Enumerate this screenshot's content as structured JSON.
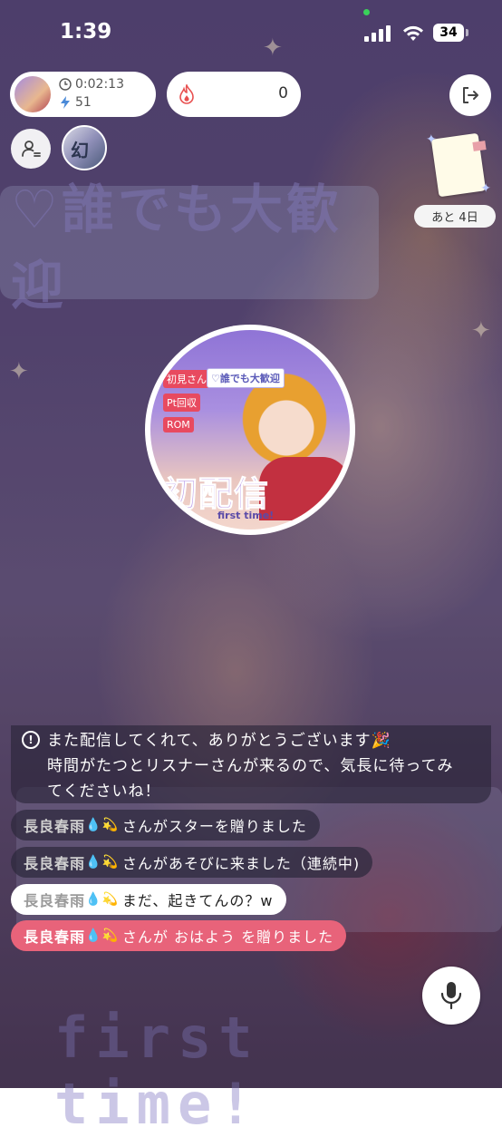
{
  "status_bar": {
    "time": "1:39",
    "battery": "34"
  },
  "stream_info": {
    "elapsed": "0:02:13",
    "count": "51",
    "score": "0"
  },
  "event": {
    "days_left": "あと 4日"
  },
  "background": {
    "banner_text": "♡誰でも大歓迎",
    "bottom_text": "first time!"
  },
  "cover": {
    "tag_1": "初見さん",
    "tag_2": "Pt回収",
    "tag_3": "ROM",
    "tag_welcome": "♡誰でも大歓迎",
    "title": "初配信",
    "subtitle": "first time!"
  },
  "chat": {
    "system": {
      "line1": "また配信してくれて、ありがとうございます🎉",
      "line2": "時間がたつとリスナーさんが来るので、気長に待ってみ",
      "line3": "てくださいね！"
    },
    "messages": [
      {
        "name": "長良春雨",
        "emoji": "💧💫",
        "text": " さんがスターを贈りました"
      },
      {
        "name": "長良春雨",
        "emoji": "💧💫",
        "text": "さんがあそびに来ました（連続中)"
      },
      {
        "name": "長良春雨",
        "emoji": "💧💫",
        "text": " まだ、起きてんの？w"
      },
      {
        "name": "長良春雨",
        "emoji": "💧💫",
        "text": " さんが おはよう を贈りました"
      }
    ]
  },
  "colors": {
    "accent_pink": "#e8637a",
    "flame": "#e85050"
  }
}
